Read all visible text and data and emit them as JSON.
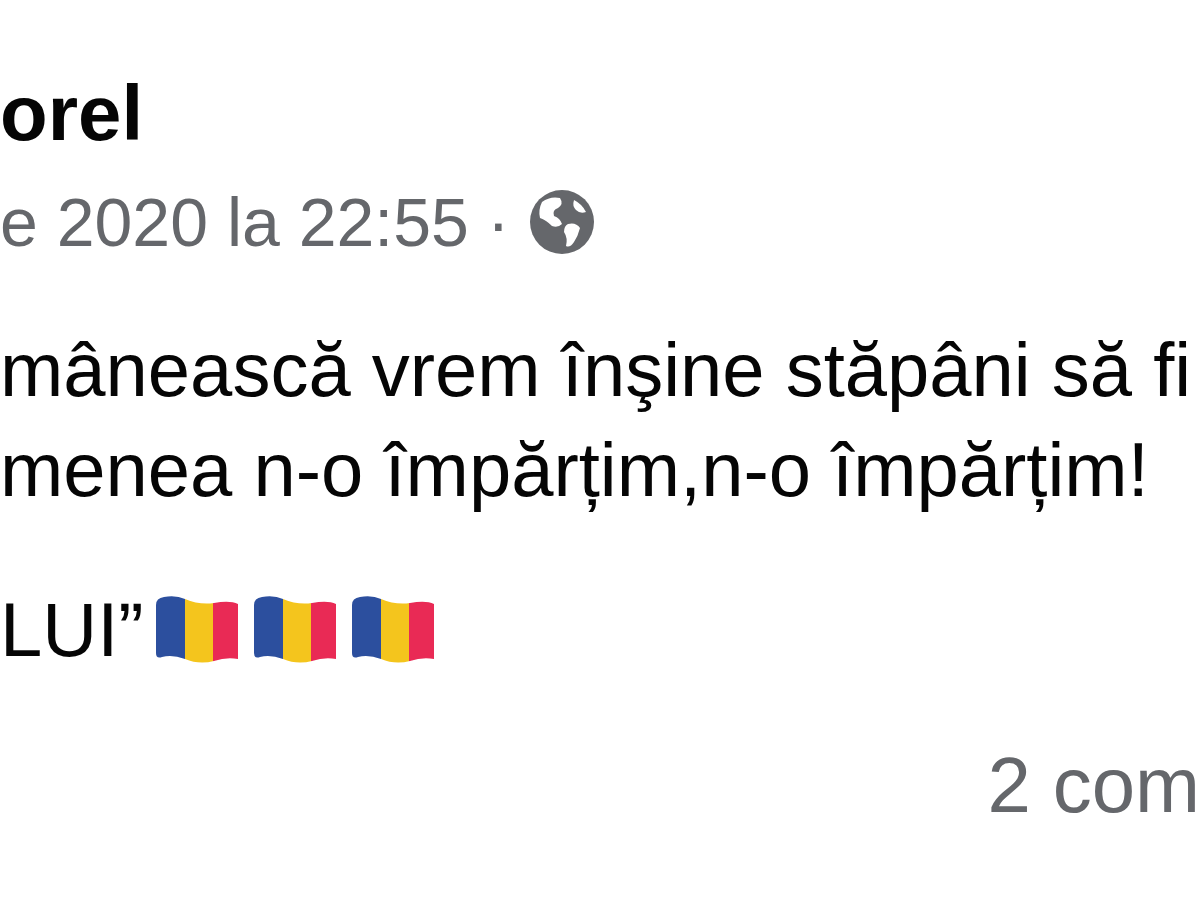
{
  "post": {
    "author": "orel",
    "timestamp": "e 2020 la 22:55",
    "separator": "·",
    "paragraphs": [
      {
        "lines": [
          "mânească vrem înşine stăpâni să fi",
          "menea n-o împărțim,n-o împărțim!"
        ]
      },
      {
        "lines": [
          "LUI”"
        ],
        "emojis": [
          {
            "kind": "flag"
          },
          {
            "kind": "flag"
          },
          {
            "kind": "flag"
          }
        ]
      }
    ],
    "comments": "2 com"
  }
}
